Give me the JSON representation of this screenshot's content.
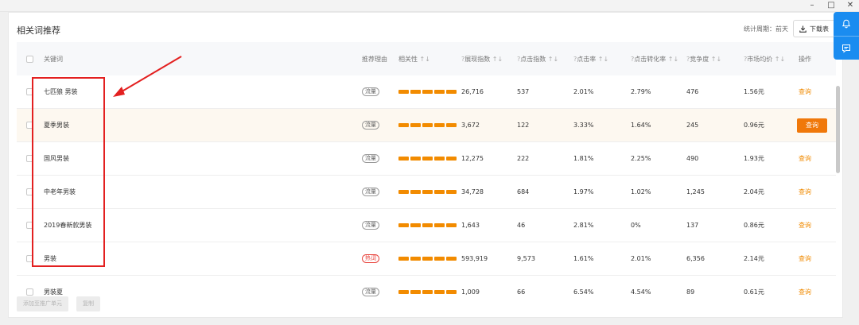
{
  "window": {
    "controls": [
      "–",
      "□",
      "✕"
    ]
  },
  "panel": {
    "title": "相关词推荐",
    "period": "统计周期：前天",
    "download_label": "下载表"
  },
  "columns": {
    "keyword": "关键词",
    "reason": "推荐理由",
    "relevance": "相关性",
    "impressions": "展现指数",
    "clicks": "点击指数",
    "ctr": "点击率",
    "cvr": "点击转化率",
    "competition": "竞争度",
    "avg_price": "市场均价",
    "action": "操作",
    "help_mark": "?",
    "sort_mark": "↑↓"
  },
  "rows": [
    {
      "keyword": "七匹狼 男装",
      "reason": "流量",
      "reason_type": "normal",
      "impressions": "26,716",
      "clicks": "537",
      "ctr": "2.01%",
      "cvr": "2.79%",
      "competition": "476",
      "price": "1.56元",
      "action": "查询"
    },
    {
      "keyword": "夏季男装",
      "reason": "流量",
      "reason_type": "normal",
      "impressions": "3,672",
      "clicks": "122",
      "ctr": "3.33%",
      "cvr": "1.64%",
      "competition": "245",
      "price": "0.96元",
      "action": "查询"
    },
    {
      "keyword": "国风男装",
      "reason": "流量",
      "reason_type": "normal",
      "impressions": "12,275",
      "clicks": "222",
      "ctr": "1.81%",
      "cvr": "2.25%",
      "competition": "490",
      "price": "1.93元",
      "action": "查询"
    },
    {
      "keyword": "中老年男装",
      "reason": "流量",
      "reason_type": "normal",
      "impressions": "34,728",
      "clicks": "684",
      "ctr": "1.97%",
      "cvr": "1.02%",
      "competition": "1,245",
      "price": "2.04元",
      "action": "查询"
    },
    {
      "keyword": "2019春新款男装",
      "reason": "流量",
      "reason_type": "normal",
      "impressions": "1,643",
      "clicks": "46",
      "ctr": "2.81%",
      "cvr": "0%",
      "competition": "137",
      "price": "0.86元",
      "action": "查询"
    },
    {
      "keyword": "男装",
      "reason": "热词",
      "reason_type": "hot",
      "impressions": "593,919",
      "clicks": "9,573",
      "ctr": "1.61%",
      "cvr": "2.01%",
      "competition": "6,356",
      "price": "2.14元",
      "action": "查询"
    },
    {
      "keyword": "男装夏",
      "reason": "流量",
      "reason_type": "normal",
      "impressions": "1,009",
      "clicks": "66",
      "ctr": "6.54%",
      "cvr": "4.54%",
      "competition": "89",
      "price": "0.61元",
      "action": "查询"
    }
  ],
  "bottom": {
    "add_button": "添加至推广单元",
    "copy_button": "复制"
  },
  "colors": {
    "accent": "#f0780a",
    "relevance_bar": "#f28b00",
    "side_tools": "#1a8cf0",
    "highlight": "#e32020"
  },
  "icons": {
    "side_tools": [
      "bell-icon",
      "message-icon"
    ],
    "download": "download-icon"
  }
}
